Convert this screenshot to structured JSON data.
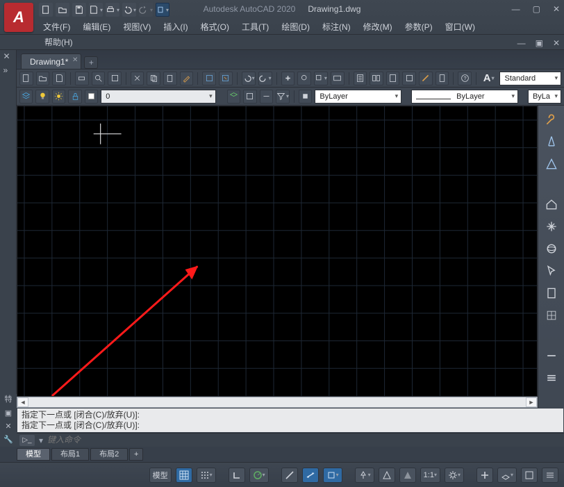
{
  "title": {
    "app": "Autodesk AutoCAD 2020",
    "doc": "Drawing1.dwg"
  },
  "menu": {
    "file": "文件(F)",
    "edit": "编辑(E)",
    "view": "视图(V)",
    "insert": "插入(I)",
    "format": "格式(O)",
    "tools": "工具(T)",
    "draw": "绘图(D)",
    "dimension": "标注(N)",
    "modify": "修改(M)",
    "param": "参数(P)",
    "window": "窗口(W)",
    "help": "帮助(H)"
  },
  "file_tab": {
    "name": "Drawing1*"
  },
  "row2": {
    "layer_color": "0",
    "bylayer1": "ByLayer",
    "bylayer2": "ByLayer",
    "bylayer3": "ByLa",
    "standard": "Standard"
  },
  "scroll": {
    "left": "◄",
    "right": "►"
  },
  "cmd": {
    "hist1": "指定下一点或 [闭合(C)/放弃(U)]:",
    "hist2": "指定下一点或 [闭合(C)/放弃(U)]:",
    "placeholder": "键入命令"
  },
  "layouts": {
    "model": "模型",
    "l1": "布局1",
    "l2": "布局2",
    "plus": "+"
  },
  "status": {
    "model": "模型",
    "ratio": "1:1"
  }
}
